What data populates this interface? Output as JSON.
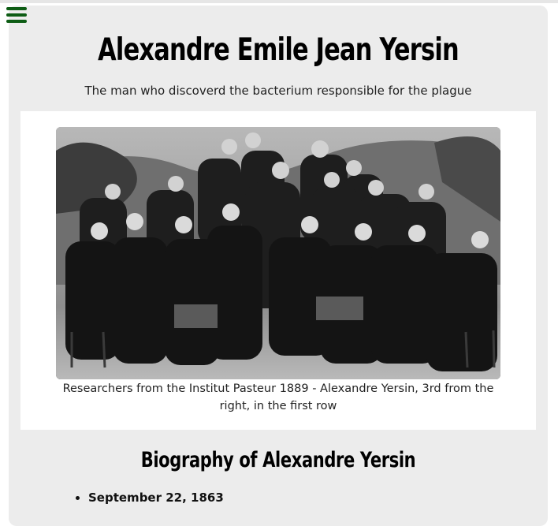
{
  "page": {
    "title": "Alexandre Emile Jean Yersin",
    "subtitle": "The man who discoverd the bacterium responsible for the plague"
  },
  "menu": {
    "icon": "hamburger-menu-icon",
    "color": "#0d5c14"
  },
  "figure": {
    "image_description_icon": "group-photo",
    "caption": "Researchers from the Institut Pasteur 1889 - Alexandre Yersin, 3rd from the right, in the first row"
  },
  "biography": {
    "heading": "Biography of Alexandre Yersin",
    "items": [
      "September 22, 1863"
    ]
  },
  "colors": {
    "panel": "#ececec",
    "accent": "#0d5c14"
  }
}
